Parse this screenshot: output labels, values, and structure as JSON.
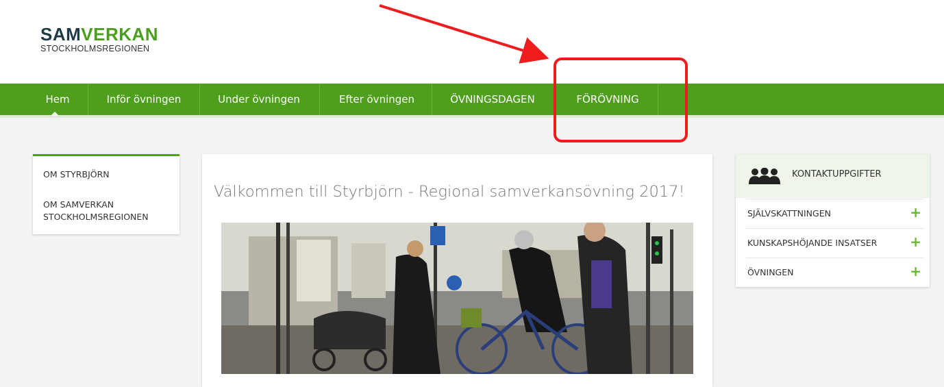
{
  "logo": {
    "part1": "SAM",
    "part2": "VERKAN",
    "sub": "STOCKHOLMSREGIONEN"
  },
  "nav": {
    "items": [
      {
        "label": "Hem"
      },
      {
        "label": "Inför övningen"
      },
      {
        "label": "Under övningen"
      },
      {
        "label": "Efter övningen"
      },
      {
        "label": "ÖVNINGSDAGEN"
      },
      {
        "label": "FÖRÖVNING"
      }
    ]
  },
  "sidebar_left": {
    "links": [
      {
        "label": "OM STYRBJÖRN"
      },
      {
        "label": "OM SAMVERKAN STOCKHOLMSREGIONEN"
      }
    ]
  },
  "main": {
    "title": "Välkommen till Styrbjörn - Regional samverkansövning 2017!"
  },
  "sidebar_right": {
    "header": "KONTAKTUPPGIFTER",
    "items": [
      {
        "label": "SJÄLVSKATTNINGEN",
        "toggle": "+"
      },
      {
        "label": "KUNSKAPSHÖJANDE INSATSER",
        "toggle": "+"
      },
      {
        "label": "ÖVNINGEN",
        "toggle": "+"
      }
    ]
  },
  "colors": {
    "nav_green": "#4e9f1c",
    "plus_green": "#6bb535",
    "annotation_red": "#ee1c1c",
    "logo_dark": "#1d3a44"
  }
}
